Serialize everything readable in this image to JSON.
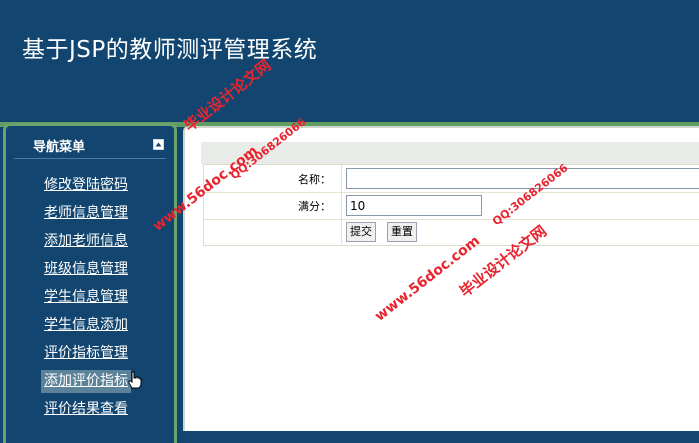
{
  "app": {
    "title": "基于JSP的教师测评管理系统"
  },
  "sidebar": {
    "title": "导航菜单",
    "collapse_icon": "collapse-icon",
    "items": [
      {
        "label": "修改登陆密码"
      },
      {
        "label": "老师信息管理"
      },
      {
        "label": "添加老师信息"
      },
      {
        "label": "班级信息管理"
      },
      {
        "label": "学生信息管理"
      },
      {
        "label": "学生信息添加"
      },
      {
        "label": "评价指标管理"
      },
      {
        "label": "添加评价指标"
      },
      {
        "label": "评价结果查看"
      }
    ],
    "active_index": 7
  },
  "form": {
    "name_label": "名称：",
    "name_value": "",
    "score_label": "满分：",
    "score_value": "10",
    "submit_label": "提交",
    "reset_label": "重置"
  },
  "watermarks": [
    {
      "line1": "毕业设计论文网",
      "line2": "www.56doc.com",
      "line3": "QQ:306826066"
    },
    {
      "line1": "QQ:306826066",
      "line2": "www.56doc.com",
      "line3": "毕业设计论文网"
    }
  ],
  "colors": {
    "header_bg": "#124670",
    "accent_green": "#5f9d63",
    "active_item_bg": "#5b8299",
    "watermark": "#e8242f"
  }
}
